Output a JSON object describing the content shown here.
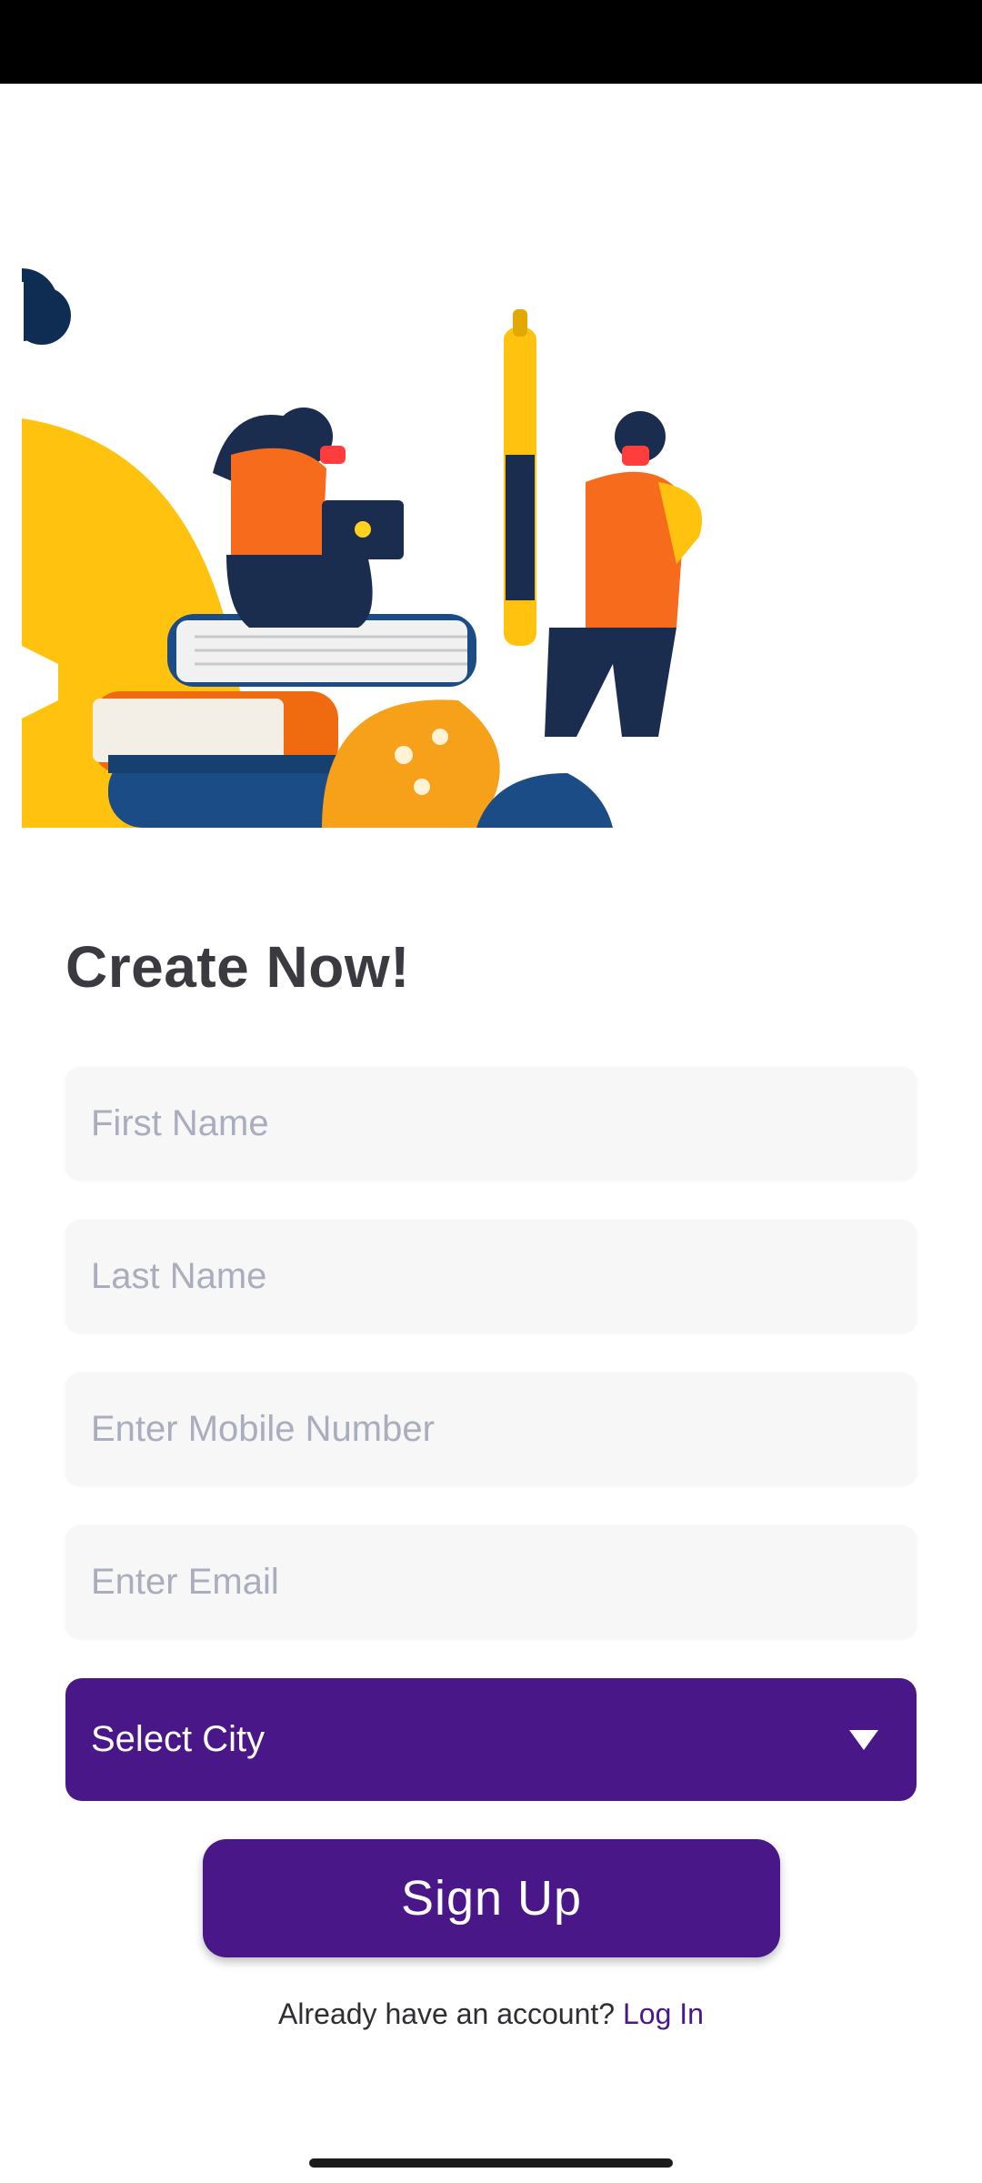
{
  "form": {
    "title": "Create Now!",
    "first_name_placeholder": "First Name",
    "last_name_placeholder": "Last Name",
    "mobile_placeholder": "Enter Mobile Number",
    "email_placeholder": "Enter Email",
    "city_label": "Select City",
    "signup_label": "Sign Up"
  },
  "footer": {
    "prompt": "Already have an account?",
    "login_label": "Log In"
  },
  "icons": {
    "city_dropdown": "caret-down-icon"
  },
  "colors": {
    "accent": "#4a1789",
    "field_bg": "#f7f7f7",
    "title": "#3a3a40",
    "placeholder": "#a9adbd"
  }
}
